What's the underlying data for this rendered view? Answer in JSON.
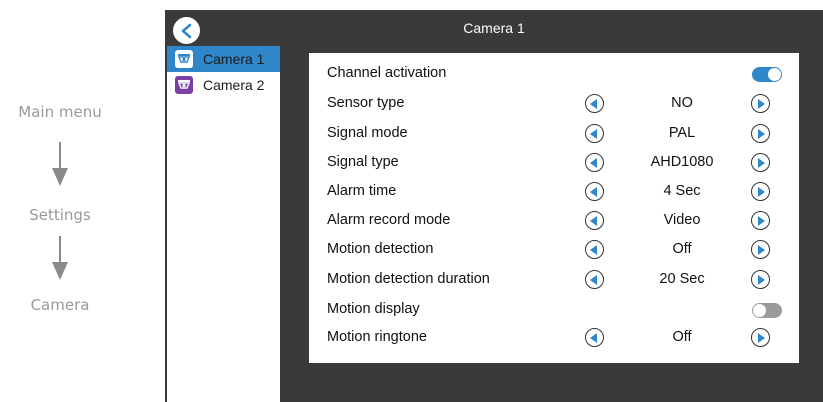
{
  "breadcrumb": {
    "main_menu": "Main menu",
    "settings": "Settings",
    "camera": "Camera"
  },
  "header": {
    "title": "Camera 1"
  },
  "sidebar": {
    "items": [
      {
        "label": "Camera 1",
        "active": true,
        "icon": "camera-icon",
        "icon_color": "#2f86c9"
      },
      {
        "label": "Camera 2",
        "active": false,
        "icon": "camera-icon",
        "icon_color": "#7b3fa6"
      }
    ]
  },
  "settings": {
    "channel_activation": {
      "label": "Channel activation",
      "enabled": true
    },
    "sensor_type": {
      "label": "Sensor type",
      "value": "NO"
    },
    "signal_mode": {
      "label": "Signal mode",
      "value": "PAL"
    },
    "signal_type": {
      "label": "Signal type",
      "value": "AHD1080"
    },
    "alarm_time": {
      "label": "Alarm time",
      "value": "4 Sec"
    },
    "alarm_record_mode": {
      "label": "Alarm record mode",
      "value": "Video"
    },
    "motion_detection": {
      "label": "Motion detection",
      "value": "Off"
    },
    "motion_detection_duration": {
      "label": "Motion detection duration",
      "value": "20 Sec"
    },
    "motion_display": {
      "label": "Motion display",
      "enabled": false
    },
    "motion_ringtone": {
      "label": "Motion ringtone",
      "value": "Off"
    }
  },
  "colors": {
    "accent": "#2f86c9",
    "screen_bg": "#3a3a3a",
    "toggle_off": "#9b9b9b"
  }
}
